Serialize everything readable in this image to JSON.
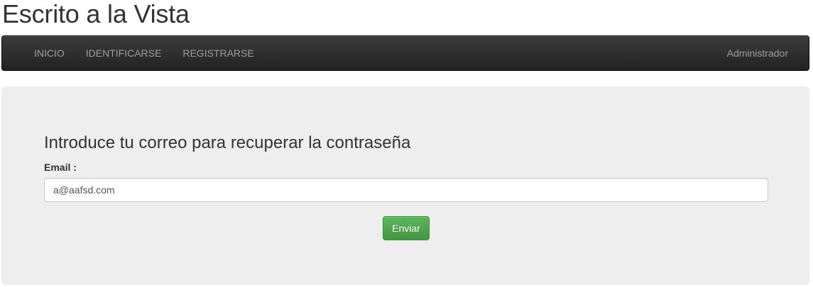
{
  "header": {
    "site_title": "Escrito a la Vista"
  },
  "nav": {
    "items": [
      {
        "label": "INICIO"
      },
      {
        "label": "IDENTIFICARSE"
      },
      {
        "label": "REGISTRARSE"
      }
    ],
    "right_label": "Administrador"
  },
  "form": {
    "heading": "Introduce tu correo para recuperar la contraseña",
    "email_label": "Email :",
    "email_value": "a@aafsd.com",
    "submit_label": "Enviar"
  },
  "colors": {
    "navbar_bg": "#222222",
    "nav_text": "#9d9d9d",
    "panel_bg": "#eeeeee",
    "button_green": "#5cb85c"
  }
}
